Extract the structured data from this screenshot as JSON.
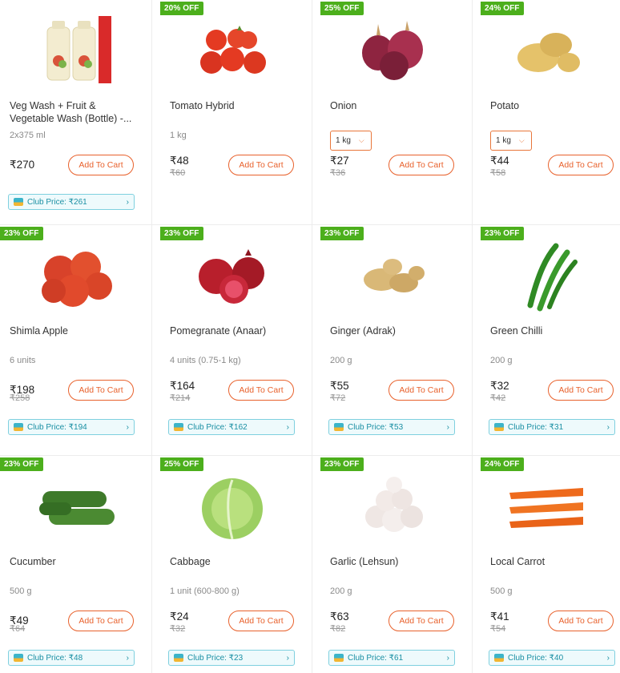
{
  "products": [
    {
      "badge": "",
      "name": "Veg Wash + Fruit & Vegetable Wash (Bottle) -...",
      "qty": "2x375 ml",
      "qty_select": "",
      "price": "₹270",
      "mrp": "",
      "cart": "Add To Cart",
      "club": "Club Price: ₹261",
      "icon": "bottle-icon"
    },
    {
      "badge": "20% OFF",
      "name": "Tomato Hybrid",
      "qty": "1 kg",
      "qty_select": "",
      "price": "₹48",
      "mrp": "₹60",
      "cart": "Add To Cart",
      "club": "",
      "icon": "tomato-icon"
    },
    {
      "badge": "25% OFF",
      "name": "Onion",
      "qty": "",
      "qty_select": "1 kg",
      "price": "₹27",
      "mrp": "₹36",
      "cart": "Add To Cart",
      "club": "",
      "icon": "onion-icon"
    },
    {
      "badge": "24% OFF",
      "name": "Potato",
      "qty": "",
      "qty_select": "1 kg",
      "price": "₹44",
      "mrp": "₹58",
      "cart": "Add To Cart",
      "club": "",
      "icon": "potato-icon"
    },
    {
      "badge": "23% OFF",
      "name": "Shimla Apple",
      "qty": "6 units",
      "qty_select": "",
      "price": "₹198",
      "mrp": "₹258",
      "cart": "Add To Cart",
      "club": "Club Price: ₹194",
      "icon": "apple-icon"
    },
    {
      "badge": "23% OFF",
      "name": "Pomegranate (Anaar)",
      "qty": "4 units (0.75-1 kg)",
      "qty_select": "",
      "price": "₹164",
      "mrp": "₹214",
      "cart": "Add To Cart",
      "club": "Club Price: ₹162",
      "icon": "pomegranate-icon"
    },
    {
      "badge": "23% OFF",
      "name": "Ginger (Adrak)",
      "qty": "200 g",
      "qty_select": "",
      "price": "₹55",
      "mrp": "₹72",
      "cart": "Add To Cart",
      "club": "Club Price: ₹53",
      "icon": "ginger-icon"
    },
    {
      "badge": "23% OFF",
      "name": "Green Chilli",
      "qty": "200 g",
      "qty_select": "",
      "price": "₹32",
      "mrp": "₹42",
      "cart": "Add To Cart",
      "club": "Club Price: ₹31",
      "icon": "chilli-icon"
    },
    {
      "badge": "23% OFF",
      "name": "Cucumber",
      "qty": "500 g",
      "qty_select": "",
      "price": "₹49",
      "mrp": "₹64",
      "cart": "Add To Cart",
      "club": "Club Price: ₹48",
      "icon": "cucumber-icon"
    },
    {
      "badge": "25% OFF",
      "name": "Cabbage",
      "qty": "1 unit (600-800 g)",
      "qty_select": "",
      "price": "₹24",
      "mrp": "₹32",
      "cart": "Add To Cart",
      "club": "Club Price: ₹23",
      "icon": "cabbage-icon"
    },
    {
      "badge": "23% OFF",
      "name": "Garlic (Lehsun)",
      "qty": "200 g",
      "qty_select": "",
      "price": "₹63",
      "mrp": "₹82",
      "cart": "Add To Cart",
      "club": "Club Price: ₹61",
      "icon": "garlic-icon"
    },
    {
      "badge": "24% OFF",
      "name": "Local Carrot",
      "qty": "500 g",
      "qty_select": "",
      "price": "₹41",
      "mrp": "₹54",
      "cart": "Add To Cart",
      "club": "Club Price: ₹40",
      "icon": "carrot-icon"
    }
  ],
  "colors": {
    "badge": "#4caf1c",
    "cart_accent": "#e8612c",
    "club_accent": "#1a8fa3"
  }
}
